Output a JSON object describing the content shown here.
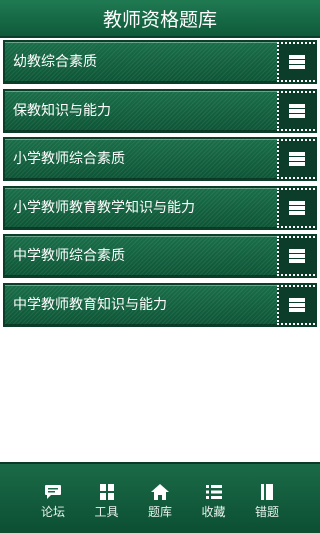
{
  "header": {
    "title": "教师资格题库"
  },
  "subjects": [
    {
      "label": "幼教综合素质"
    },
    {
      "label": "保教知识与能力"
    },
    {
      "label": "小学教师综合素质"
    },
    {
      "label": "小学教师教育教学知识与能力"
    },
    {
      "label": "中学教师综合素质"
    },
    {
      "label": "中学教师教育知识与能力"
    }
  ],
  "row_button_icon": "menu-lines-icon",
  "tabbar": {
    "tabs": [
      {
        "label": "论坛",
        "icon": "chat-bubble-icon"
      },
      {
        "label": "工具",
        "icon": "grid-icon"
      },
      {
        "label": "题库",
        "icon": "home-icon"
      },
      {
        "label": "收藏",
        "icon": "list-icon"
      },
      {
        "label": "错题",
        "icon": "book-icon"
      }
    ]
  },
  "colors": {
    "primary": "#1a6e49",
    "dark": "#0b3d2a",
    "text": "#ffffff"
  }
}
